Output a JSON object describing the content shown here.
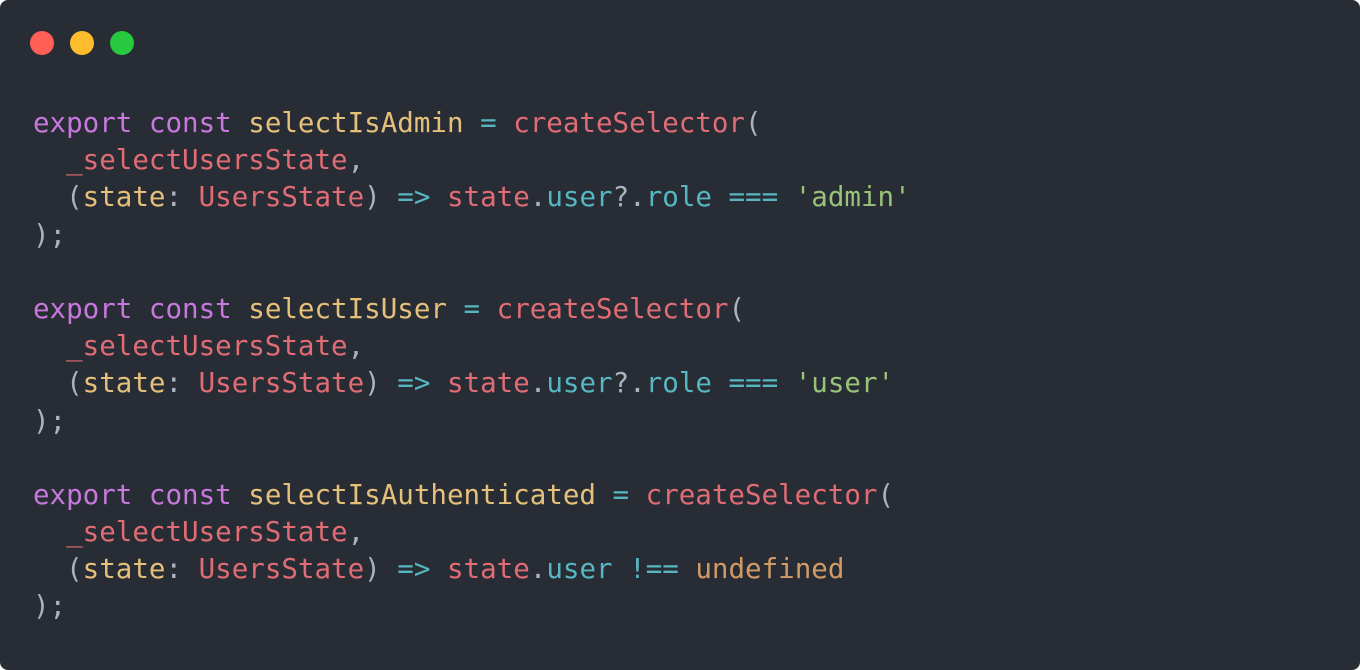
{
  "window": {
    "controls": [
      {
        "name": "close",
        "color": "#ff5f56"
      },
      {
        "name": "minimize",
        "color": "#ffbd2e"
      },
      {
        "name": "maximize",
        "color": "#27c93f"
      }
    ]
  },
  "colors": {
    "background": "#282c34",
    "keyword": "#c678dd",
    "function": "#e5c07b",
    "red": "#e06c75",
    "cyan": "#56b6c2",
    "string": "#98c379",
    "orange": "#d19a66",
    "plain": "#abb2bf"
  },
  "code_lines": [
    [
      {
        "t": "export",
        "c": "keyword"
      },
      {
        "t": " ",
        "c": "plain"
      },
      {
        "t": "const",
        "c": "keyword"
      },
      {
        "t": " ",
        "c": "plain"
      },
      {
        "t": "selectIsAdmin",
        "c": "function"
      },
      {
        "t": " ",
        "c": "plain"
      },
      {
        "t": "=",
        "c": "cyan"
      },
      {
        "t": " ",
        "c": "plain"
      },
      {
        "t": "createSelector",
        "c": "red"
      },
      {
        "t": "(",
        "c": "plain"
      }
    ],
    [
      {
        "t": "  ",
        "c": "plain"
      },
      {
        "t": "_selectUsersState",
        "c": "red"
      },
      {
        "t": ",",
        "c": "plain"
      }
    ],
    [
      {
        "t": "  (",
        "c": "plain"
      },
      {
        "t": "state",
        "c": "function"
      },
      {
        "t": ": ",
        "c": "plain"
      },
      {
        "t": "UsersState",
        "c": "red"
      },
      {
        "t": ") ",
        "c": "plain"
      },
      {
        "t": "=>",
        "c": "cyan"
      },
      {
        "t": " ",
        "c": "plain"
      },
      {
        "t": "state",
        "c": "red"
      },
      {
        "t": ".",
        "c": "plain"
      },
      {
        "t": "user",
        "c": "cyan"
      },
      {
        "t": "?.",
        "c": "plain"
      },
      {
        "t": "role",
        "c": "cyan"
      },
      {
        "t": " ",
        "c": "plain"
      },
      {
        "t": "===",
        "c": "cyan"
      },
      {
        "t": " ",
        "c": "plain"
      },
      {
        "t": "'admin'",
        "c": "string"
      }
    ],
    [
      {
        "t": ");",
        "c": "plain"
      }
    ],
    [],
    [
      {
        "t": "export",
        "c": "keyword"
      },
      {
        "t": " ",
        "c": "plain"
      },
      {
        "t": "const",
        "c": "keyword"
      },
      {
        "t": " ",
        "c": "plain"
      },
      {
        "t": "selectIsUser",
        "c": "function"
      },
      {
        "t": " ",
        "c": "plain"
      },
      {
        "t": "=",
        "c": "cyan"
      },
      {
        "t": " ",
        "c": "plain"
      },
      {
        "t": "createSelector",
        "c": "red"
      },
      {
        "t": "(",
        "c": "plain"
      }
    ],
    [
      {
        "t": "  ",
        "c": "plain"
      },
      {
        "t": "_selectUsersState",
        "c": "red"
      },
      {
        "t": ",",
        "c": "plain"
      }
    ],
    [
      {
        "t": "  (",
        "c": "plain"
      },
      {
        "t": "state",
        "c": "function"
      },
      {
        "t": ": ",
        "c": "plain"
      },
      {
        "t": "UsersState",
        "c": "red"
      },
      {
        "t": ") ",
        "c": "plain"
      },
      {
        "t": "=>",
        "c": "cyan"
      },
      {
        "t": " ",
        "c": "plain"
      },
      {
        "t": "state",
        "c": "red"
      },
      {
        "t": ".",
        "c": "plain"
      },
      {
        "t": "user",
        "c": "cyan"
      },
      {
        "t": "?.",
        "c": "plain"
      },
      {
        "t": "role",
        "c": "cyan"
      },
      {
        "t": " ",
        "c": "plain"
      },
      {
        "t": "===",
        "c": "cyan"
      },
      {
        "t": " ",
        "c": "plain"
      },
      {
        "t": "'user'",
        "c": "string"
      }
    ],
    [
      {
        "t": ");",
        "c": "plain"
      }
    ],
    [],
    [
      {
        "t": "export",
        "c": "keyword"
      },
      {
        "t": " ",
        "c": "plain"
      },
      {
        "t": "const",
        "c": "keyword"
      },
      {
        "t": " ",
        "c": "plain"
      },
      {
        "t": "selectIsAuthenticated",
        "c": "function"
      },
      {
        "t": " ",
        "c": "plain"
      },
      {
        "t": "=",
        "c": "cyan"
      },
      {
        "t": " ",
        "c": "plain"
      },
      {
        "t": "createSelector",
        "c": "red"
      },
      {
        "t": "(",
        "c": "plain"
      }
    ],
    [
      {
        "t": "  ",
        "c": "plain"
      },
      {
        "t": "_selectUsersState",
        "c": "red"
      },
      {
        "t": ",",
        "c": "plain"
      }
    ],
    [
      {
        "t": "  (",
        "c": "plain"
      },
      {
        "t": "state",
        "c": "function"
      },
      {
        "t": ": ",
        "c": "plain"
      },
      {
        "t": "UsersState",
        "c": "red"
      },
      {
        "t": ") ",
        "c": "plain"
      },
      {
        "t": "=>",
        "c": "cyan"
      },
      {
        "t": " ",
        "c": "plain"
      },
      {
        "t": "state",
        "c": "red"
      },
      {
        "t": ".",
        "c": "plain"
      },
      {
        "t": "user",
        "c": "cyan"
      },
      {
        "t": " ",
        "c": "plain"
      },
      {
        "t": "!==",
        "c": "cyan"
      },
      {
        "t": " ",
        "c": "plain"
      },
      {
        "t": "undefined",
        "c": "orange"
      }
    ],
    [
      {
        "t": ");",
        "c": "plain"
      }
    ]
  ]
}
